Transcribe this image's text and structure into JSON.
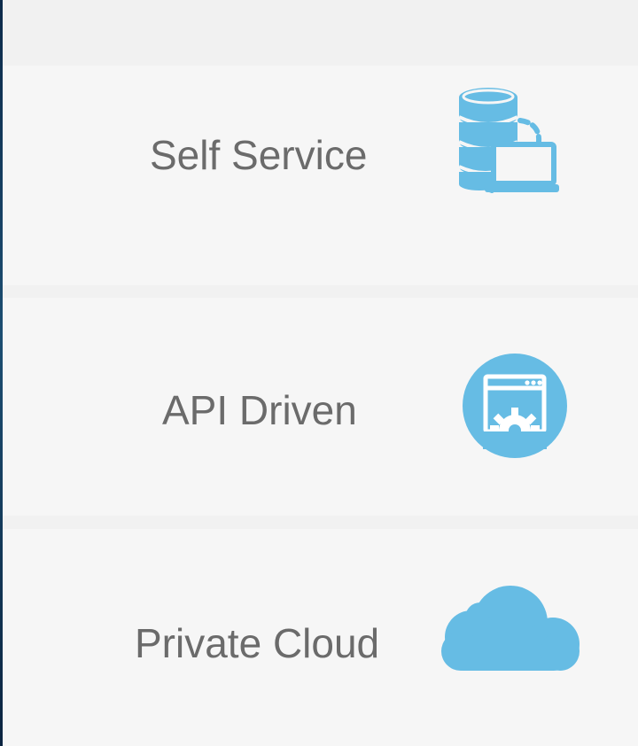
{
  "features": [
    {
      "label": "Self Service",
      "icon": "database-laptop-icon"
    },
    {
      "label": "API Driven",
      "icon": "browser-gear-icon"
    },
    {
      "label": "Private Cloud",
      "icon": "cloud-icon"
    }
  ],
  "colors": {
    "background": "#f1f1f1",
    "card": "#f6f6f6",
    "text": "#6b6b6b",
    "accent": "#66bce4",
    "edge": "#1c4e72"
  }
}
